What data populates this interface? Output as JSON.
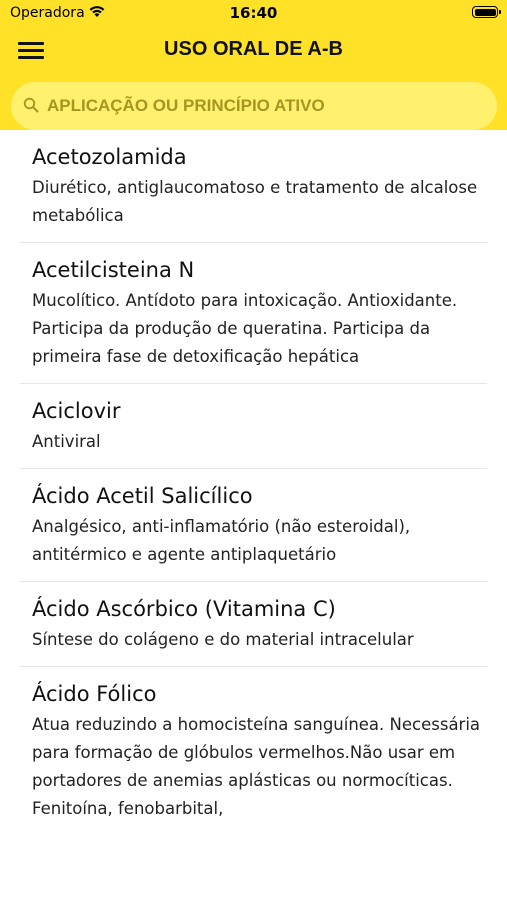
{
  "status_bar": {
    "carrier": "Operadora",
    "time": "16:40"
  },
  "header": {
    "title": "USO ORAL DE A-B"
  },
  "search": {
    "placeholder": "APLICAÇÃO OU PRINCÍPIO ATIVO"
  },
  "list": {
    "items": [
      {
        "name": "Acetozolamida",
        "description": "Diurético, antiglaucomatoso e tratamento de alcalose metabólica"
      },
      {
        "name": "Acetilcisteina N",
        "description": "Mucolítico. Antídoto para intoxicação. Antioxidante. Participa da produção de queratina. Participa da primeira fase de detoxificação hepática"
      },
      {
        "name": "Aciclovir",
        "description": "Antiviral"
      },
      {
        "name": "Ácido Acetil Salicílico",
        "description": "Analgésico, anti-inflamatório (não esteroidal), antitérmico e agente antiplaquetário"
      },
      {
        "name": "Ácido Ascórbico (Vitamina C)",
        "description": "Síntese do colágeno e do material intracelular"
      },
      {
        "name": "Ácido Fólico",
        "description": "Atua reduzindo a homocisteína sanguínea. Necessária para formação de glóbulos vermelhos.Não usar em portadores de anemias aplásticas ou normocíticas. Fenitoína, fenobarbital,"
      }
    ]
  }
}
